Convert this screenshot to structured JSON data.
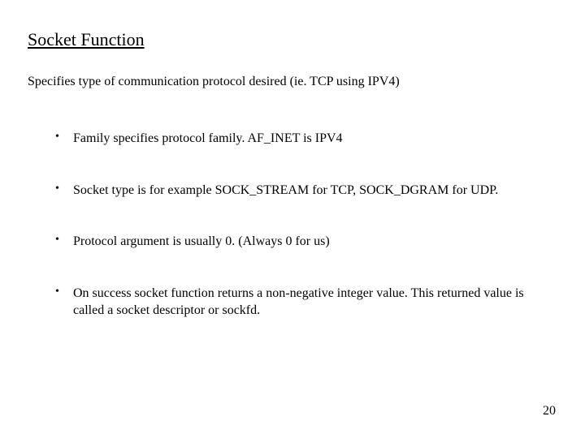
{
  "slide": {
    "title": "Socket Function",
    "subtitle": "Specifies type of communication protocol desired (ie. TCP using IPV4)",
    "bullets": [
      "Family specifies protocol family. AF_INET is IPV4",
      "Socket type is for example SOCK_STREAM for TCP, SOCK_DGRAM for UDP.",
      "Protocol argument is usually 0. (Always 0 for us)",
      "On success socket function returns a non-negative integer value. This returned value is called a socket descriptor or   sockfd."
    ],
    "page_number": "20"
  }
}
